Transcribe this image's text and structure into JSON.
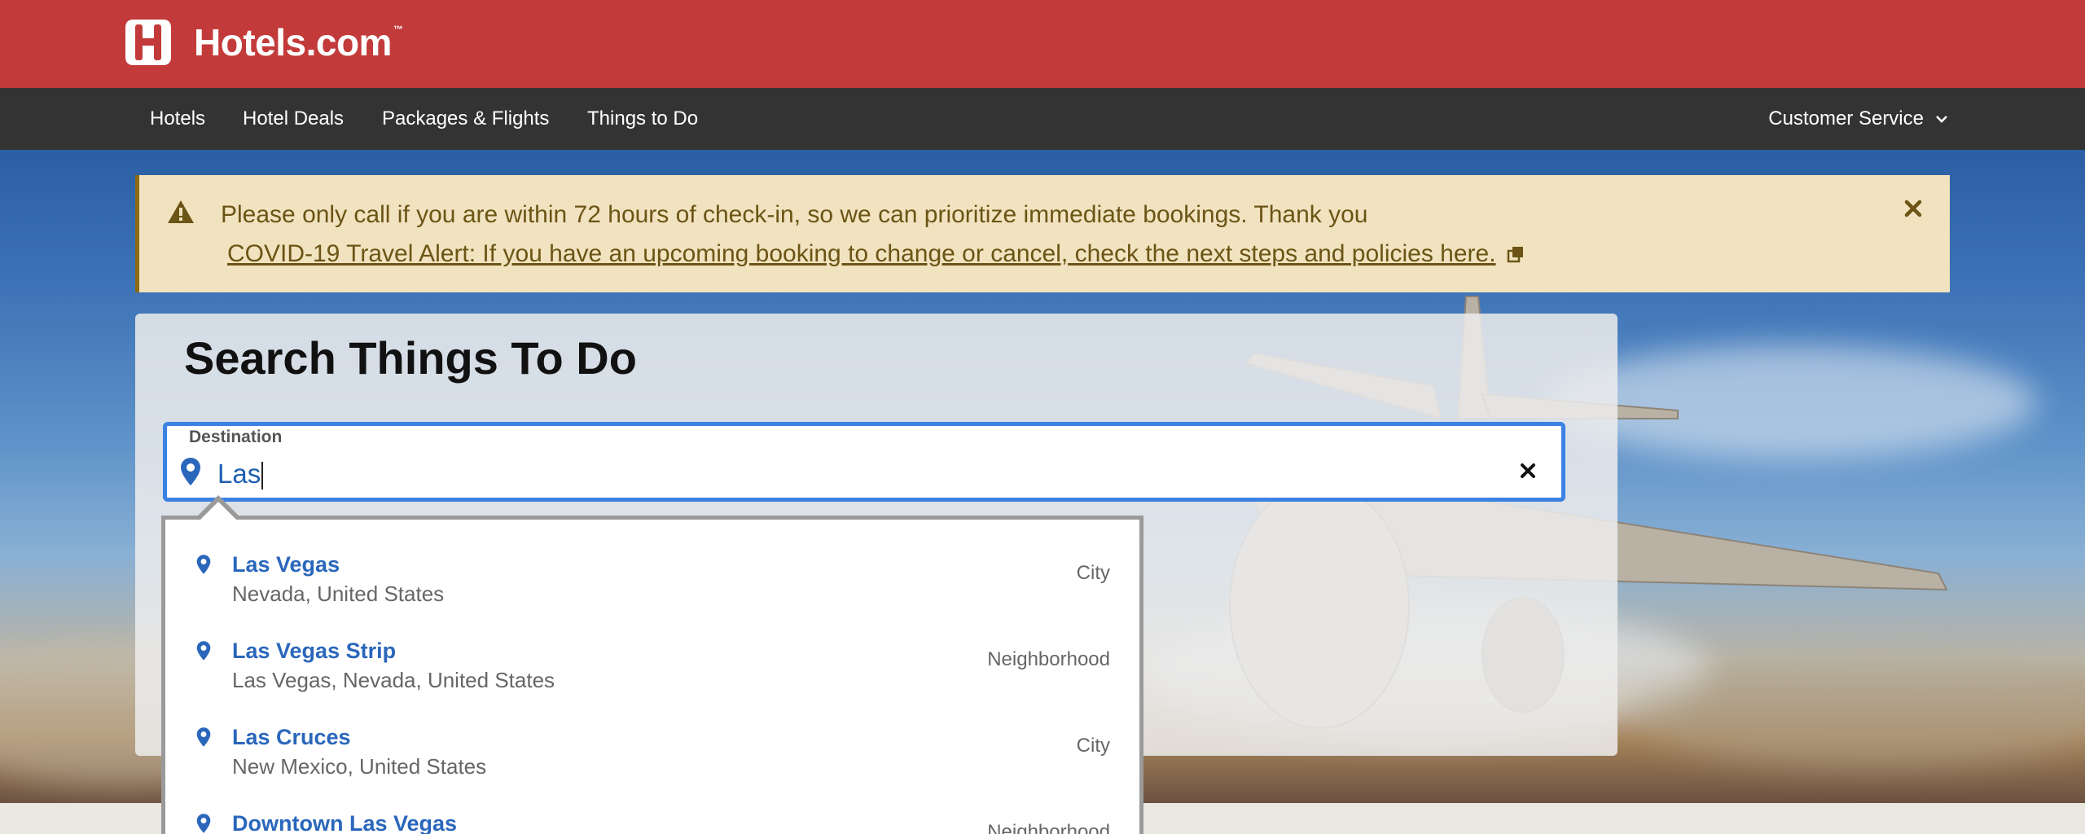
{
  "header": {
    "brand": "Hotels.com",
    "trademark": "™",
    "brand_color": "#c23b3a"
  },
  "nav": {
    "items": [
      {
        "label": "Hotels"
      },
      {
        "label": "Hotel Deals"
      },
      {
        "label": "Packages & Flights"
      },
      {
        "label": "Things to Do"
      }
    ],
    "customer_service": "Customer Service"
  },
  "alert": {
    "message": "Please only call if you are within 72 hours of check-in, so we can prioritize immediate bookings. Thank you",
    "link_text": "COVID-19 Travel Alert: If you have an upcoming booking to change or cancel, check the next steps and policies here.",
    "icons": [
      "warning-icon",
      "external-link-icon",
      "close-icon"
    ]
  },
  "search": {
    "title": "Search Things To Do",
    "destination_label": "Destination",
    "destination_value": "Las",
    "icons": [
      "location-pin-icon",
      "clear-icon"
    ]
  },
  "suggestions": [
    {
      "name": "Las Vegas",
      "sub": "Nevada, United States",
      "type": "City"
    },
    {
      "name": "Las Vegas Strip",
      "sub": "Las Vegas, Nevada, United States",
      "type": "Neighborhood"
    },
    {
      "name": "Las Cruces",
      "sub": "New Mexico, United States",
      "type": "City"
    },
    {
      "name": "Downtown Las Vegas",
      "sub": "",
      "type": "Neighborhood"
    }
  ],
  "colors": {
    "accent_blue": "#3b82e2",
    "link_blue": "#2a67bb",
    "alert_bg": "#f1e3bf",
    "nav_bg": "#333333"
  }
}
